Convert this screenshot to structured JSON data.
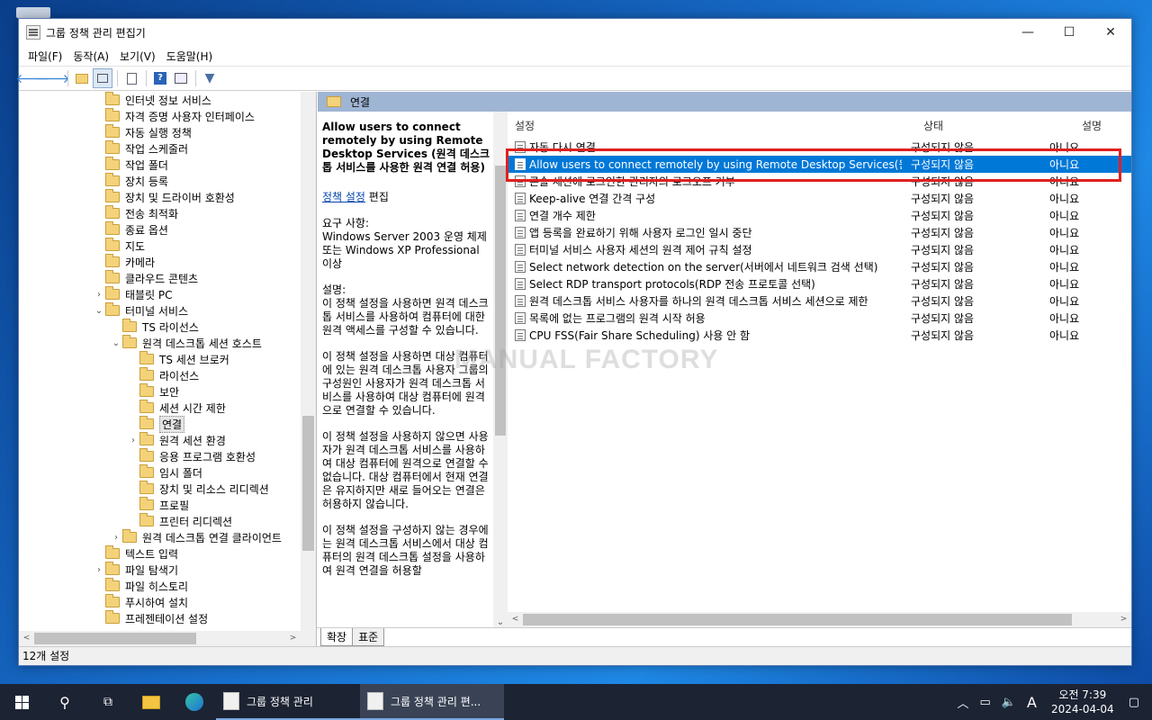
{
  "window": {
    "title": "그룹 정책 관리 편집기",
    "minimize": "—",
    "maximize": "☐",
    "close": "✕"
  },
  "menu": [
    "파일(F)",
    "동작(A)",
    "보기(V)",
    "도움말(H)"
  ],
  "toolbar_icons": [
    "back-arrow-icon",
    "forward-arrow-icon",
    "up-folder-icon",
    "show-hide-tree-icon",
    "export-list-icon",
    "help-icon",
    "properties-icon",
    "filter-icon"
  ],
  "tree": {
    "items": [
      {
        "label": "인터넷 정보 서비스",
        "indent": 0,
        "expander": ""
      },
      {
        "label": "자격 증명 사용자 인터페이스",
        "indent": 0,
        "expander": ""
      },
      {
        "label": "자동 실행 정책",
        "indent": 0,
        "expander": ""
      },
      {
        "label": "작업 스케줄러",
        "indent": 0,
        "expander": ""
      },
      {
        "label": "작업 폴더",
        "indent": 0,
        "expander": ""
      },
      {
        "label": "장치 등록",
        "indent": 0,
        "expander": ""
      },
      {
        "label": "장치 및 드라이버 호환성",
        "indent": 0,
        "expander": ""
      },
      {
        "label": "전송 최적화",
        "indent": 0,
        "expander": ""
      },
      {
        "label": "종료 옵션",
        "indent": 0,
        "expander": ""
      },
      {
        "label": "지도",
        "indent": 0,
        "expander": ""
      },
      {
        "label": "카메라",
        "indent": 0,
        "expander": ""
      },
      {
        "label": "클라우드 콘텐츠",
        "indent": 0,
        "expander": ""
      },
      {
        "label": "태블릿 PC",
        "indent": 0,
        "expander": "›"
      },
      {
        "label": "터미널 서비스",
        "indent": 0,
        "expander": "⌄"
      },
      {
        "label": "TS 라이선스",
        "indent": 1,
        "expander": ""
      },
      {
        "label": "원격 데스크톱 세션 호스트",
        "indent": 1,
        "expander": "⌄"
      },
      {
        "label": "TS 세션 브로커",
        "indent": 2,
        "expander": ""
      },
      {
        "label": "라이선스",
        "indent": 2,
        "expander": ""
      },
      {
        "label": "보안",
        "indent": 2,
        "expander": ""
      },
      {
        "label": "세션 시간 제한",
        "indent": 2,
        "expander": ""
      },
      {
        "label": "연결",
        "indent": 2,
        "expander": "",
        "selected": true
      },
      {
        "label": "원격 세션 환경",
        "indent": 2,
        "expander": "›"
      },
      {
        "label": "응용 프로그램 호환성",
        "indent": 2,
        "expander": ""
      },
      {
        "label": "임시 폴더",
        "indent": 2,
        "expander": ""
      },
      {
        "label": "장치 및 리소스 리디렉션",
        "indent": 2,
        "expander": ""
      },
      {
        "label": "프로필",
        "indent": 2,
        "expander": ""
      },
      {
        "label": "프린터 리디렉션",
        "indent": 2,
        "expander": ""
      },
      {
        "label": "원격 데스크톱 연결 클라이언트",
        "indent": 1,
        "expander": "›"
      },
      {
        "label": "텍스트 입력",
        "indent": 0,
        "expander": ""
      },
      {
        "label": "파일 탐색기",
        "indent": 0,
        "expander": "›"
      },
      {
        "label": "파일 히스토리",
        "indent": 0,
        "expander": ""
      },
      {
        "label": "푸시하여 설치",
        "indent": 0,
        "expander": ""
      },
      {
        "label": "프레젠테이션 설정",
        "indent": 0,
        "expander": ""
      }
    ]
  },
  "right_header": "연결",
  "description": {
    "title": "Allow users to connect remotely by using Remote Desktop Services (원격 데스크톱 서비스를 사용한 원격 연결 허용)",
    "edit_link": "정책 설정",
    "edit_suffix": " 편집",
    "requirements_label": "요구 사항:",
    "requirements": "Windows Server 2003 운영 체제 또는 Windows XP Professional 이상",
    "desc_label": "설명:",
    "p1": "이 정책 설정을 사용하면 원격 데스크톱 서비스를 사용하여 컴퓨터에 대한 원격 액세스를 구성할 수 있습니다.",
    "p2": "이 정책 설정을 사용하면 대상 컴퓨터에 있는 원격 데스크톱 사용자 그룹의 구성원인 사용자가 원격 데스크톱 서비스를 사용하여 대상 컴퓨터에 원격으로 연결할 수 있습니다.",
    "p3": "이 정책 설정을 사용하지 않으면 사용자가 원격 데스크톱 서비스를 사용하여 대상 컴퓨터에 원격으로 연결할 수 없습니다. 대상 컴퓨터에서 현재 연결은 유지하지만 새로 들어오는 연결은 허용하지 않습니다.",
    "p4": "이 정책 설정을 구성하지 않는 경우에는 원격 데스크톱 서비스에서 대상 컴퓨터의 원격 데스크톱 설정을 사용하여 원격 연결을 허용할"
  },
  "list": {
    "columns": [
      "설정",
      "상태",
      "설명"
    ],
    "rows": [
      {
        "name": "자동 다시 연결",
        "state": "구성되지 않음",
        "comment": "아니요"
      },
      {
        "name": "Allow users to connect remotely by using Remote Desktop Services(원격 ...",
        "state": "구성되지 않음",
        "comment": "아니요",
        "selected": true
      },
      {
        "name": "콘솔 세션에 로그인한 관리자의 로그오프 거부",
        "state": "구성되지 않음",
        "comment": "아니요"
      },
      {
        "name": "Keep-alive 연결 간격 구성",
        "state": "구성되지 않음",
        "comment": "아니요"
      },
      {
        "name": "연결 개수 제한",
        "state": "구성되지 않음",
        "comment": "아니요"
      },
      {
        "name": "앱 등록을 완료하기 위해 사용자 로그인 일시 중단",
        "state": "구성되지 않음",
        "comment": "아니요"
      },
      {
        "name": "터미널 서비스 사용자 세션의 원격 제어 규칙 설정",
        "state": "구성되지 않음",
        "comment": "아니요"
      },
      {
        "name": "Select network detection on the server(서버에서 네트워크 검색 선택)",
        "state": "구성되지 않음",
        "comment": "아니요"
      },
      {
        "name": "Select RDP transport protocols(RDP 전송 프로토콜 선택)",
        "state": "구성되지 않음",
        "comment": "아니요"
      },
      {
        "name": "원격 데스크톱 서비스 사용자를 하나의 원격 데스크톱 서비스 세션으로 제한",
        "state": "구성되지 않음",
        "comment": "아니요"
      },
      {
        "name": "목록에 없는 프로그램의 원격 시작 허용",
        "state": "구성되지 않음",
        "comment": "아니요"
      },
      {
        "name": "CPU FSS(Fair Share Scheduling) 사용 안 함",
        "state": "구성되지 않음",
        "comment": "아니요"
      }
    ]
  },
  "tabs": [
    "확장",
    "표준"
  ],
  "status": "12개 설정",
  "watermark": "MANUAL FACTORY",
  "taskbar": {
    "apps": [
      {
        "label": "그룹 정책 관리",
        "active": false
      },
      {
        "label": "그룹 정책 관리 편...",
        "active": true
      }
    ],
    "ime": "A",
    "time": "오전 7:39",
    "date": "2024-04-04"
  },
  "colors": {
    "selection": "#0078d7",
    "highlight_box": "#e02020",
    "pane_header": "#9fb5d4"
  }
}
